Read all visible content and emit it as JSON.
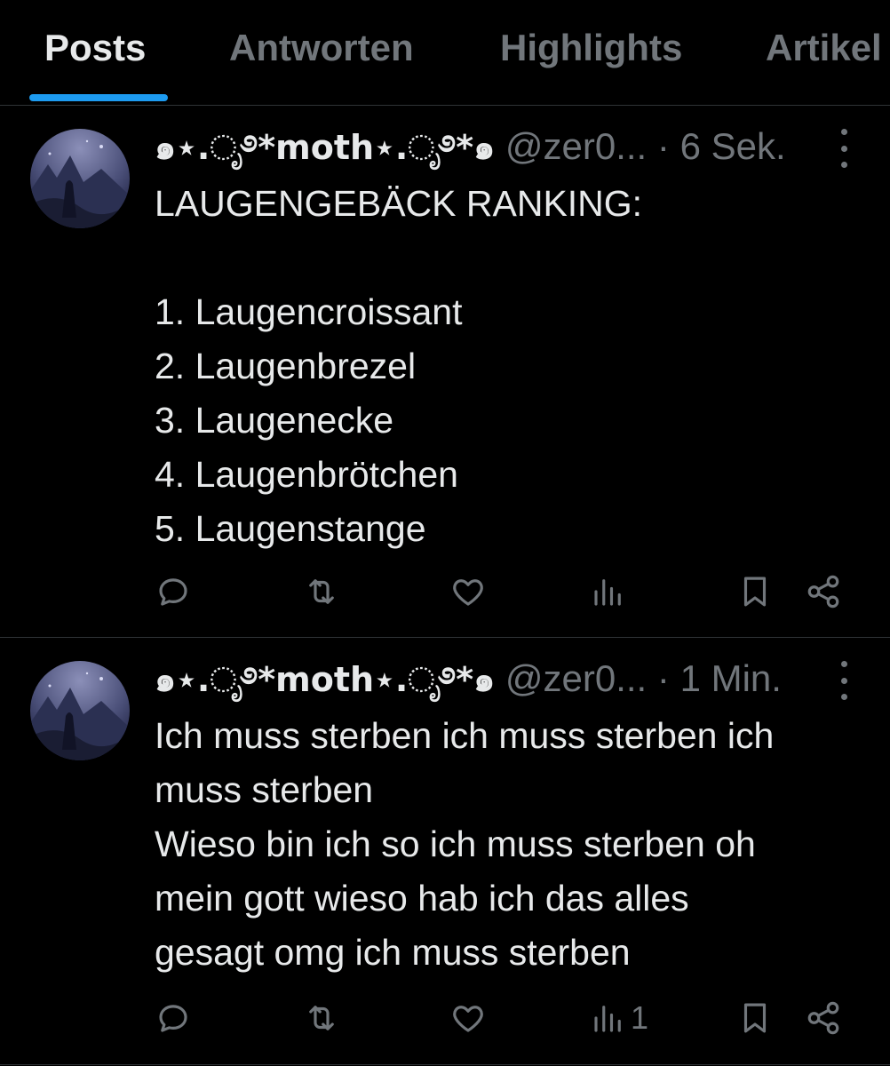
{
  "tabs": [
    {
      "label": "Posts",
      "active": true
    },
    {
      "label": "Antworten",
      "active": false
    },
    {
      "label": "Highlights",
      "active": false
    },
    {
      "label": "Artikel",
      "active": false
    }
  ],
  "colors": {
    "accent": "#1d9bf0",
    "background": "#000000",
    "text": "#e7e9ea",
    "muted": "#71767b",
    "divider": "#2f3336"
  },
  "posts": [
    {
      "author_name": "๑⋆.ೃ࿔*moth⋆.ೃ࿔*๑",
      "handle": "@zer0...",
      "separator": "·",
      "time": "6 Sek.",
      "lines": [
        "LAUGENGEBÄCK RANKING:",
        "",
        "1.  Laugencroissant",
        "2. Laugenbrezel",
        "3. Laugenecke",
        "4. Laugenbrötchen",
        "5. Laugenstange"
      ],
      "views": ""
    },
    {
      "author_name": "๑⋆.ೃ࿔*moth⋆.ೃ࿔*๑",
      "handle": "@zer0...",
      "separator": "·",
      "time": "1 Min.",
      "lines": [
        "Ich muss sterben ich muss sterben ich",
        "muss sterben",
        "Wieso bin ich so ich muss sterben oh",
        "mein gott wieso hab ich das alles",
        "gesagt omg ich muss sterben"
      ],
      "views": "1"
    }
  ],
  "icons": [
    "reply-icon",
    "repost-icon",
    "like-icon",
    "views-icon",
    "bookmark-icon",
    "share-icon",
    "more-icon"
  ]
}
